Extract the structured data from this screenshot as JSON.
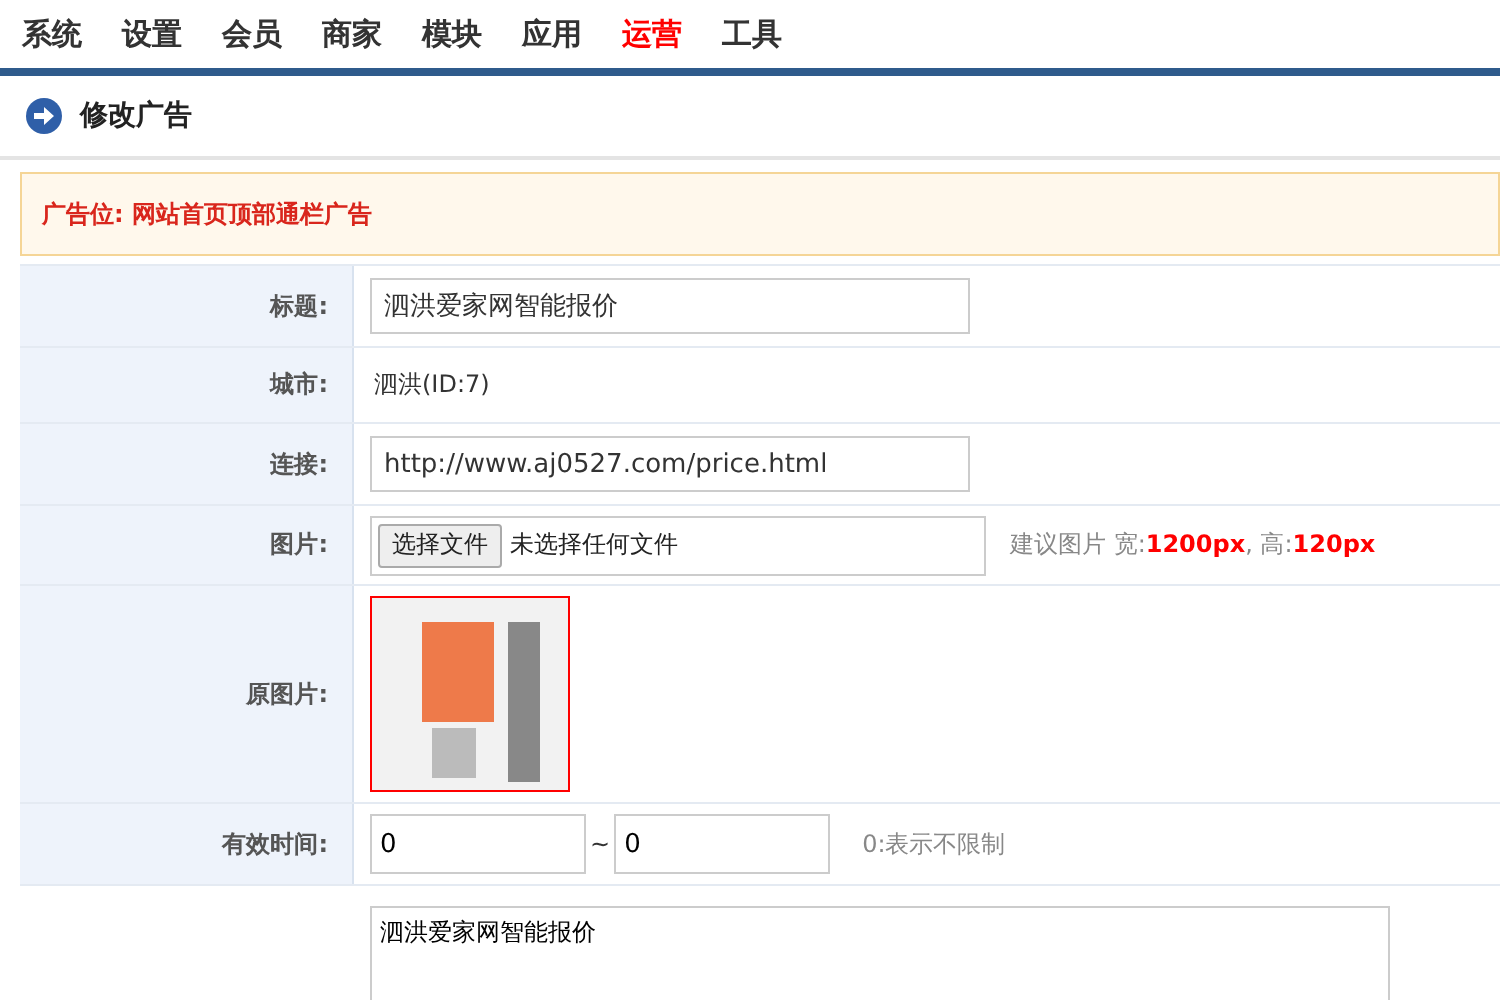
{
  "nav": [
    {
      "label": "系统",
      "selected": false
    },
    {
      "label": "设置",
      "selected": false
    },
    {
      "label": "会员",
      "selected": false
    },
    {
      "label": "商家",
      "selected": false
    },
    {
      "label": "模块",
      "selected": false
    },
    {
      "label": "应用",
      "selected": false
    },
    {
      "label": "运营",
      "selected": true
    },
    {
      "label": "工具",
      "selected": false
    }
  ],
  "page_title": "修改广告",
  "notice": "广告位: 网站首页顶部通栏广告",
  "form": [
    {
      "kind": "input",
      "label": "标题:",
      "value": "泗洪爱家网智能报价"
    },
    {
      "kind": "text",
      "label": "城市:",
      "value": "泗洪(ID:7)"
    },
    {
      "kind": "input",
      "label": "连接:",
      "value": "http://www.aj0527.com/price.html"
    },
    {
      "kind": "file",
      "label": "图片:",
      "button": "选择文件",
      "status": "未选择任何文件",
      "hint": "建议图片 宽:**1200px**, 高:**120px**"
    },
    {
      "kind": "image",
      "label": "原图片:"
    },
    {
      "kind": "range",
      "label": "有效时间:",
      "from": "0",
      "separator": "~",
      "to": "0",
      "hint": "0:表示不限制"
    },
    {
      "kind": "textarea",
      "value": "泗洪爱家网智能报价"
    }
  ]
}
